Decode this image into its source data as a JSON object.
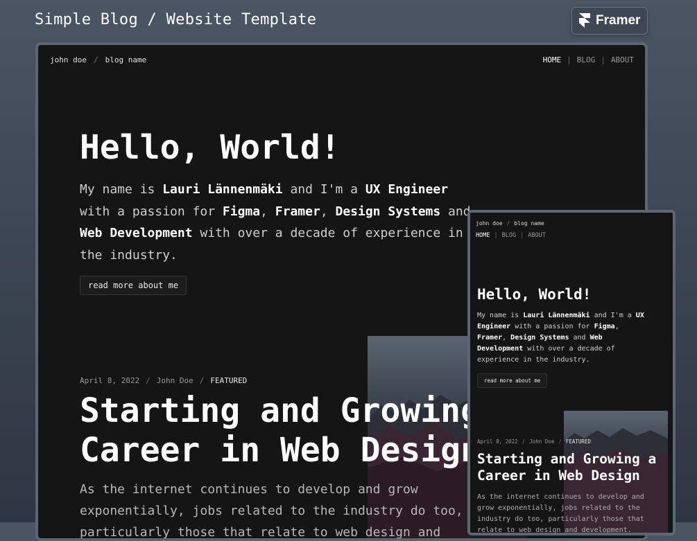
{
  "header": {
    "title": "Simple Blog / Website Template",
    "badge_label": "Framer"
  },
  "site": {
    "breadcrumb": {
      "author": "john doe",
      "sep": "/",
      "blog": "blog name"
    },
    "nav": [
      {
        "label": "HOME",
        "active": true
      },
      {
        "label": "BLOG",
        "active": false
      },
      {
        "label": "ABOUT",
        "active": false
      }
    ],
    "nav_sep": "|"
  },
  "hero": {
    "heading": "Hello, World!",
    "intro_parts": [
      {
        "text": "My name is ",
        "bold": false
      },
      {
        "text": "Lauri Lännenmäki",
        "bold": true
      },
      {
        "text": " and I'm a ",
        "bold": false
      },
      {
        "text": "UX Engineer",
        "bold": true
      },
      {
        "text": " with a passion for ",
        "bold": false
      },
      {
        "text": "Figma",
        "bold": true
      },
      {
        "text": ", ",
        "bold": false
      },
      {
        "text": "Framer",
        "bold": true
      },
      {
        "text": ", ",
        "bold": false
      },
      {
        "text": "Design Systems",
        "bold": true
      },
      {
        "text": " and ",
        "bold": false
      },
      {
        "text": "Web Development",
        "bold": true
      },
      {
        "text": " with over a decade of experience in the industry.",
        "bold": false
      }
    ],
    "button": "read more about me"
  },
  "post": {
    "date": "April 8, 2022",
    "author": "John Doe",
    "tag": "FEATURED",
    "sep": "/",
    "title_desktop": "Starting and Growing a Career in Web Design",
    "title_mobile": "Starting and Growing a Career in Web Design",
    "excerpt": "As the internet continues to develop and grow exponentially, jobs related to the industry do too, particularly those that relate to web design and development."
  },
  "colors": {
    "page_bg": "#3d4654",
    "frame_border": "#5d6673",
    "card_bg": "#151515",
    "framer_badge_bg": "#3f4754"
  }
}
